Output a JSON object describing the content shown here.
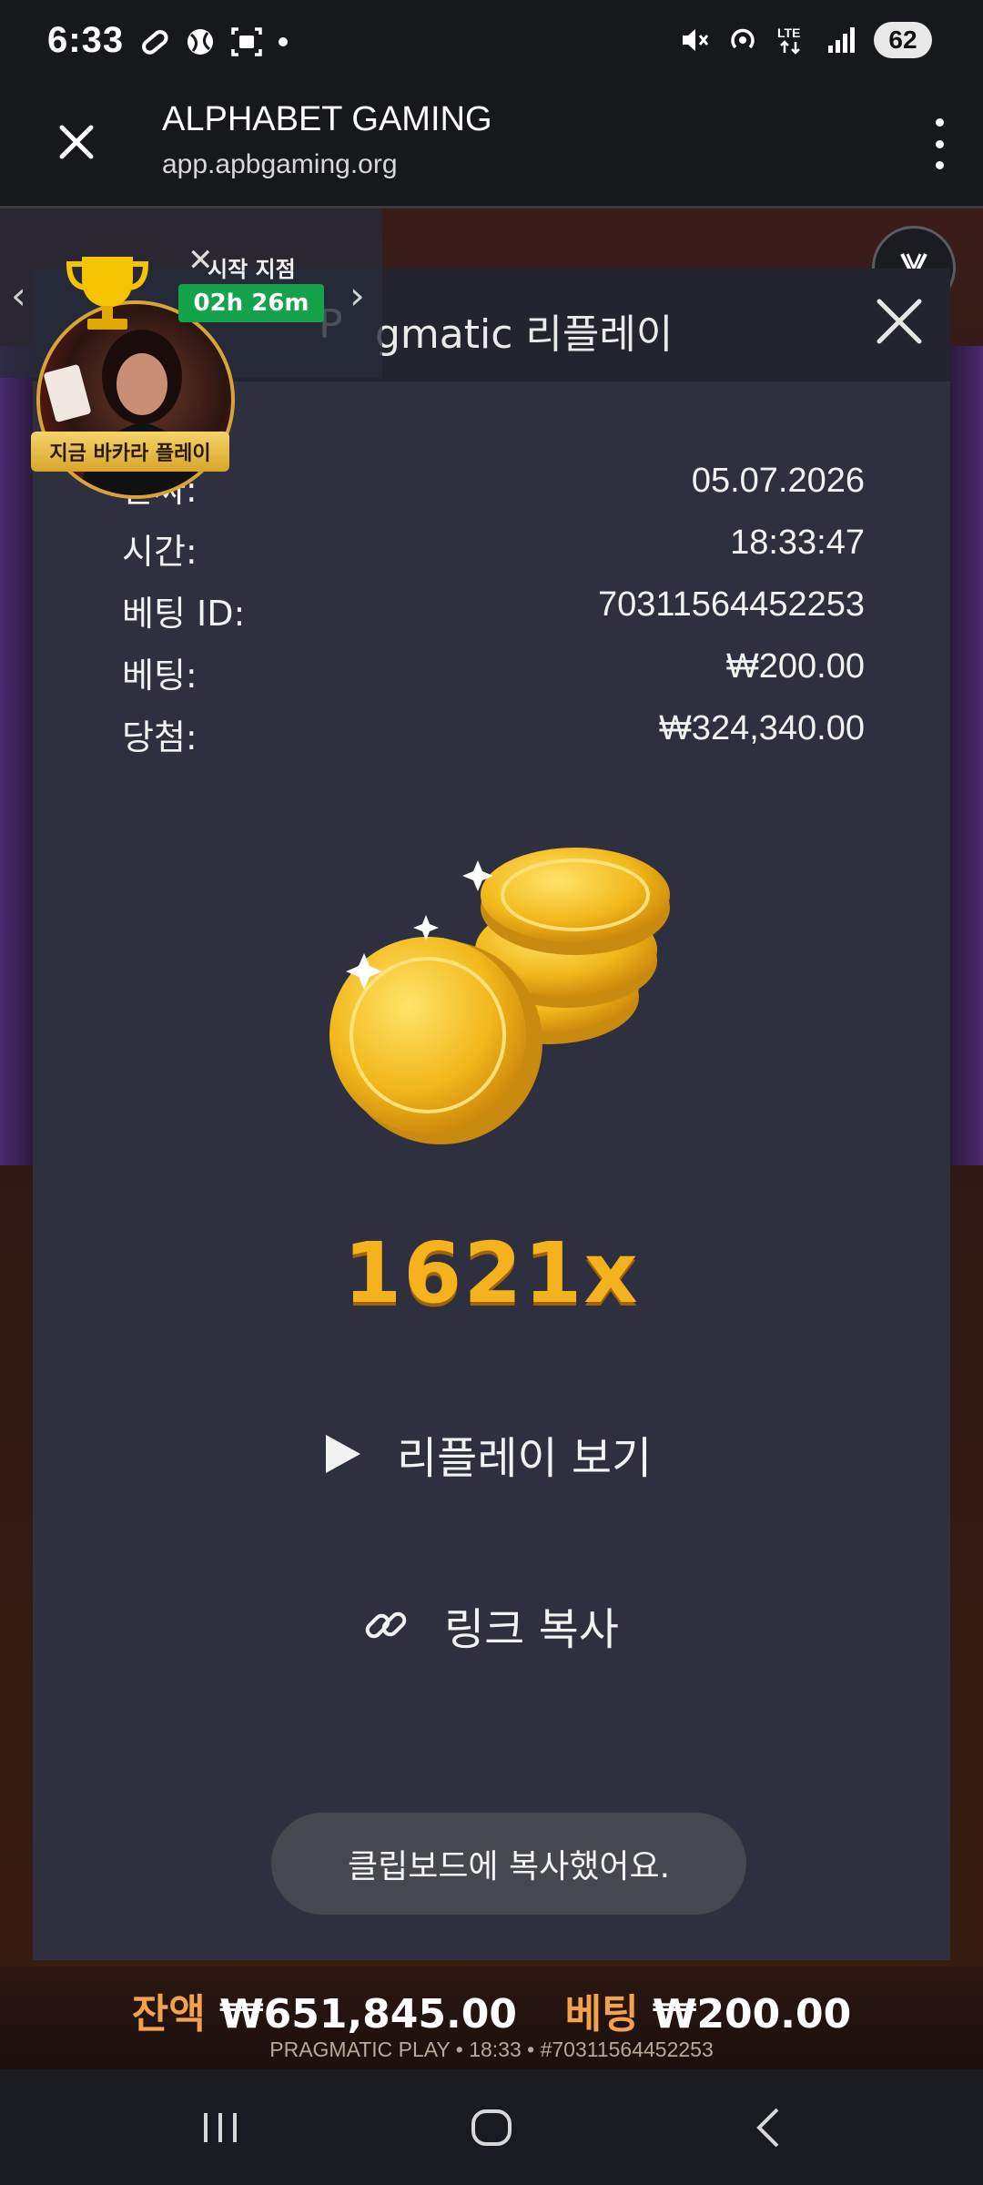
{
  "status_bar": {
    "time": "6:33",
    "battery": "62",
    "network": "LTE"
  },
  "browser": {
    "title": "ALPHABET GAMING",
    "url": "app.apbgaming.org"
  },
  "modal": {
    "title_prefix": "P",
    "title": "gmatic 리플레이",
    "rows": [
      {
        "label": "날짜:",
        "value": "05.07.2026"
      },
      {
        "label": "시간:",
        "value": "18:33:47"
      },
      {
        "label": "베팅 ID:",
        "value": "70311564452253"
      },
      {
        "label": "베팅:",
        "value": "₩200.00"
      },
      {
        "label": "당첨:",
        "value": "₩324,340.00"
      }
    ],
    "multiplier": "1621x",
    "replay_label": "리플레이 보기",
    "copy_link_label": "링크 복사",
    "toast": "클립보드에 복사했어요."
  },
  "promo": {
    "start_label": "시작 지점",
    "timer": "02h 26m",
    "caption": "지금 바카라 플레이"
  },
  "balance": {
    "balance_label": "잔액",
    "balance_value": "₩651,845.00",
    "bet_label": "베팅",
    "bet_value": "₩200.00",
    "footer": "PRAGMATIC PLAY • 18:33 • #70311564452253"
  },
  "colors": {
    "modal_bg": "#2e2f3f",
    "multiplier": "#f5b21e",
    "timer_bg": "#14a34a",
    "balance_label": "#f2a24a"
  }
}
